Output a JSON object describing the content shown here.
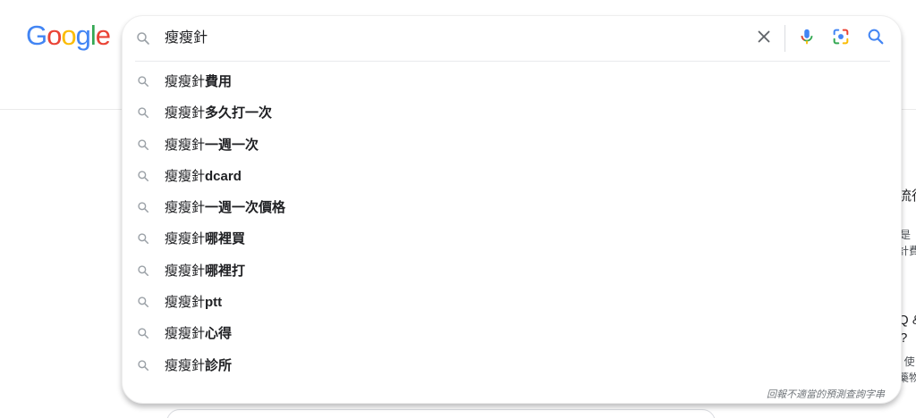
{
  "logo": {
    "letters": [
      "G",
      "o",
      "o",
      "g",
      "l",
      "e"
    ],
    "colors": [
      "#4285F4",
      "#EA4335",
      "#FBBC05",
      "#4285F4",
      "#34A853",
      "#EA4335"
    ]
  },
  "search": {
    "query": "瘦瘦針",
    "clear_icon": "close-icon",
    "voice_icon": "microphone-icon",
    "lens_icon": "camera-lens-icon",
    "search_icon": "search-icon"
  },
  "suggestions": [
    {
      "prefix": "瘦瘦針",
      "completion": "費用"
    },
    {
      "prefix": "瘦瘦針",
      "completion": "多久打一次"
    },
    {
      "prefix": "瘦瘦針",
      "completion": "一週一次"
    },
    {
      "prefix": "瘦瘦針",
      "completion": "dcard"
    },
    {
      "prefix": "瘦瘦針",
      "completion": "一週一次價格"
    },
    {
      "prefix": "瘦瘦針",
      "completion": "哪裡買"
    },
    {
      "prefix": "瘦瘦針",
      "completion": "哪裡打"
    },
    {
      "prefix": "瘦瘦針",
      "completion": "ptt"
    },
    {
      "prefix": "瘦瘦針",
      "completion": "心得"
    },
    {
      "prefix": "瘦瘦針",
      "completion": "診所"
    }
  ],
  "report_link": "回報不適當的預測查詢字串",
  "background": {
    "snippet_1": "流行",
    "snippet_2": "是",
    "snippet_3": "計費",
    "snippet_4": "Q &",
    "snippet_5": "?",
    "snippet_6": ": 使",
    "snippet_7": "藥物"
  },
  "colors": {
    "icon_gray": "#5f6368",
    "mic_blue": "#4285F4"
  }
}
